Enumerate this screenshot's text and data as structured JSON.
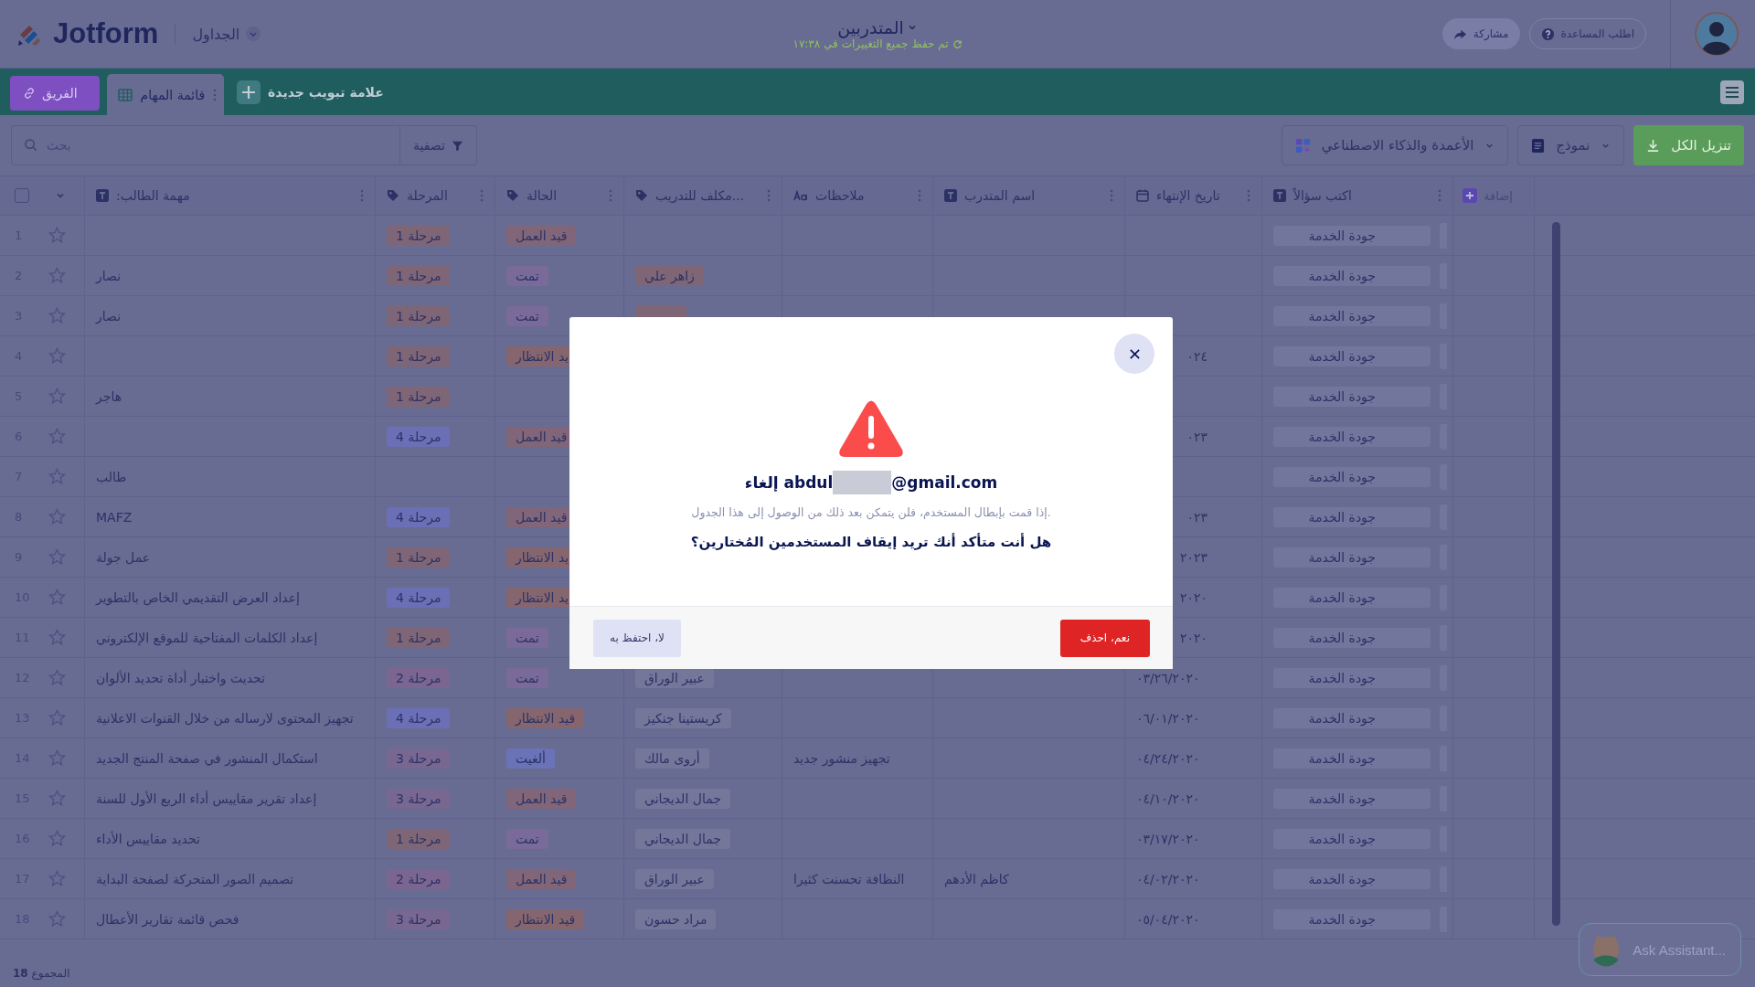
{
  "top_bar": {
    "logo": "Jotform",
    "section": "الجداول",
    "title": "المتدربين",
    "save_status": "تم حفظ جميع التغييرات في ١٧:٣٨",
    "share": "مشاركة",
    "help": "اطلب المساعدة"
  },
  "tab_bar": {
    "team_button": "الفريق",
    "tabs": [
      {
        "label": "قائمة المهام",
        "selected": true
      }
    ],
    "new_tab": "علامة تبويب جديدة"
  },
  "toolbar": {
    "search": {
      "placeholder": "بحث"
    },
    "filter": "تصفية",
    "columns_ai": "الأعمدة والذكاء الاصطناعي",
    "form": "نموذج",
    "download": "تنزيل الكل"
  },
  "table": {
    "select_all": {
      "checked": false
    },
    "columns": [
      {
        "label": "اكتب سؤالاً",
        "kind": "text"
      },
      {
        "label": "تاريخ الإنتهاء",
        "kind": "date"
      },
      {
        "label": "اسم المتدرب",
        "kind": "text"
      },
      {
        "label": "ملاحظات",
        "kind": "longtext"
      },
      {
        "label": "...مكلف للتدريب",
        "kind": "tag"
      },
      {
        "label": "الحالة",
        "kind": "tag"
      },
      {
        "label": "المرحلة",
        "kind": "tag"
      },
      {
        "label": "مهمة الطالب:",
        "kind": "text"
      }
    ],
    "add_column": "إضافة",
    "rows": [
      {
        "number": "1",
        "stage": {
          "text": "مرحلة 1",
          "color": "#7f6676"
        },
        "status": {
          "text": "قيد العمل",
          "color": "#806678"
        },
        "question": {
          "text": "جودة الخدمة",
          "color": "#72769c"
        }
      },
      {
        "number": "2",
        "task": "نصار",
        "stage": {
          "text": "مرحلة 1",
          "color": "#7f6676"
        },
        "status": {
          "text": "تمت",
          "color": "#7a6a99"
        },
        "assignee": {
          "text": "زاهر علي",
          "color": "#7f6676"
        },
        "question": {
          "text": "جودة الخدمة",
          "color": "#72769c"
        }
      },
      {
        "number": "3",
        "task": "نصار",
        "stage": {
          "text": "مرحلة 1",
          "color": "#7f6676"
        },
        "status": {
          "text": "تمت",
          "color": "#7a6a99"
        },
        "assignee": {
          "color": "#7f6676"
        },
        "question": {
          "text": "جودة الخدمة",
          "color": "#72769c"
        }
      },
      {
        "number": "4",
        "stage": {
          "text": "مرحلة 1",
          "color": "#7f6676"
        },
        "status": {
          "text": "يد الانتظار",
          "color": "#86666e",
          "partial": true
        },
        "end_date": {
          "text": "٠٢٤",
          "partial": true
        },
        "question": {
          "text": "جودة الخدمة",
          "color": "#72769c"
        }
      },
      {
        "number": "5",
        "task": "هاجر",
        "stage": {
          "text": "مرحلة 1",
          "color": "#7f6676"
        },
        "question": {
          "text": "جودة الخدمة",
          "color": "#72769c"
        }
      },
      {
        "number": "6",
        "stage": {
          "text": "مرحلة 4",
          "color": "#6b6fb5"
        },
        "status": {
          "text": "قيد العمل",
          "color": "#806678"
        },
        "end_date": {
          "text": "٠٢٣",
          "partial": true
        },
        "question": {
          "text": "جودة الخدمة",
          "color": "#72769c"
        }
      },
      {
        "number": "7",
        "task": "طالب",
        "question": {
          "text": "جودة الخدمة",
          "color": "#72769c"
        }
      },
      {
        "number": "8",
        "task": "MAFZ",
        "stage": {
          "text": "مرحلة 4",
          "color": "#6b6fb5"
        },
        "status": {
          "text": "قيد العمل",
          "color": "#806678"
        },
        "end_date": {
          "text": "٠٢٣",
          "partial": true
        },
        "question": {
          "text": "جودة الخدمة",
          "color": "#72769c"
        }
      },
      {
        "number": "9",
        "task": "عمل جولة",
        "stage": {
          "text": "مرحلة 1",
          "color": "#7f6676"
        },
        "status": {
          "text": "يد الانتظار",
          "color": "#86666e",
          "partial": true
        },
        "end_date": {
          "text": "٢٠٢٣",
          "partial": true
        },
        "question": {
          "text": "جودة الخدمة",
          "color": "#72769c"
        }
      },
      {
        "number": "10",
        "task": "إعداد العرض التقديمي الخاص بالتطوير",
        "stage": {
          "text": "مرحلة 4",
          "color": "#6b6fb5"
        },
        "status": {
          "text": "يد الانتظار",
          "color": "#86666e",
          "partial": true
        },
        "end_date": {
          "text": "٢٠٢٠",
          "partial": true
        },
        "question": {
          "text": "جودة الخدمة",
          "color": "#72769c"
        }
      },
      {
        "number": "11",
        "task": "إعداد الكلمات المفتاحية للموقع الإلكتروني",
        "stage": {
          "text": "مرحلة 1",
          "color": "#7f6676"
        },
        "status": {
          "text": "تمت",
          "color": "#7a6a99"
        },
        "end_date": {
          "text": "٢٠٢٠",
          "partial": true
        },
        "question": {
          "text": "جودة الخدمة",
          "color": "#72769c"
        }
      },
      {
        "number": "12",
        "task": "تحديث واختبار أداة تحديد الألوان",
        "stage": {
          "text": "مرحلة 2",
          "color": "#7a6690"
        },
        "status": {
          "text": "تمت",
          "color": "#7a6a99"
        },
        "assignee": {
          "text": "عبير الوراق",
          "color": "#74779a"
        },
        "end_date": {
          "text": "٠٣/٢٦/٢٠٢٠",
          "partial": false
        },
        "question": {
          "text": "جودة الخدمة",
          "color": "#72769c"
        }
      },
      {
        "number": "13",
        "task": "تجهيز المحتوى لارساله من خلال القنوات الاعلانية",
        "stage": {
          "text": "مرحلة 4",
          "color": "#6b6fb5"
        },
        "status": {
          "text": "قيد الانتظار",
          "color": "#86666e"
        },
        "assignee": {
          "text": "كريستينا جنكيز",
          "color": "#74779a"
        },
        "end_date": {
          "text": "٠٦/٠١/٢٠٢٠",
          "partial": false
        },
        "question": {
          "text": "جودة الخدمة",
          "color": "#72769c"
        }
      },
      {
        "number": "14",
        "task": "استكمال المنشور في صفحة المنتج الجديد",
        "stage": {
          "text": "مرحلة 3",
          "color": "#786790"
        },
        "status": {
          "text": "ألغيت",
          "color": "#6a72b8"
        },
        "assignee": {
          "text": "أروى مالك",
          "color": "#74779a"
        },
        "notes": "تجهيز منشور جديد",
        "end_date": {
          "text": "٠٤/٢٤/٢٠٢٠",
          "partial": false
        },
        "question": {
          "text": "جودة الخدمة",
          "color": "#72769c"
        }
      },
      {
        "number": "15",
        "task": "إعداد تقرير مقاييس أداء الربع الأول للسنة",
        "stage": {
          "text": "مرحلة 3",
          "color": "#786790"
        },
        "status": {
          "text": "قيد العمل",
          "color": "#806678"
        },
        "assignee": {
          "text": "جمال الديجاني",
          "color": "#74779a"
        },
        "end_date": {
          "text": "٠٤/١٠/٢٠٢٠",
          "partial": false
        },
        "question": {
          "text": "جودة الخدمة",
          "color": "#72769c"
        }
      },
      {
        "number": "16",
        "task": "تحديد مقاييس الأداء",
        "stage": {
          "text": "مرحلة 1",
          "color": "#7f6676"
        },
        "status": {
          "text": "تمت",
          "color": "#7a6a99"
        },
        "assignee": {
          "text": "جمال الديجاني",
          "color": "#74779a"
        },
        "end_date": {
          "text": "٠٣/١٧/٢٠٢٠",
          "partial": false
        },
        "question": {
          "text": "جودة الخدمة",
          "color": "#72769c"
        }
      },
      {
        "number": "17",
        "task": "تصميم الصور المتحركة لصفحة البداية",
        "stage": {
          "text": "مرحلة 2",
          "color": "#7a6690"
        },
        "status": {
          "text": "قيد العمل",
          "color": "#806678"
        },
        "assignee": {
          "text": "عبير الوراق",
          "color": "#74779a"
        },
        "notes": "النظافة تحسنت كثيرا",
        "trainer": "كاظم الأدهم",
        "end_date": {
          "text": "٠٤/٠٢/٢٠٢٠",
          "partial": false
        },
        "question": {
          "text": "جودة الخدمة",
          "color": "#72769c"
        }
      },
      {
        "number": "18",
        "task": "فحص قائمة تقارير الأعطال",
        "stage": {
          "text": "مرحلة 3",
          "color": "#786790"
        },
        "status": {
          "text": "قيد الانتظار",
          "color": "#86666e"
        },
        "assignee": {
          "text": "مراد حسون",
          "color": "#74779a"
        },
        "end_date": {
          "text": "٠٥/٠٤/٢٠٢٠",
          "partial": false
        },
        "question": {
          "text": "جودة الخدمة",
          "color": "#72769c"
        }
      }
    ],
    "footer": "المجموع **18**"
  },
  "assistant": "Ask Assistant...",
  "dialog": {
    "title_parts": [
      "@gmail.com",
      "إلغاء abdul"
    ],
    "message": "إذا قمت بإبطال المستخدم، فلن يتمكن بعد ذلك من الوصول إلى هذا الجدول.",
    "question": "هل أنت متأكد أنك تريد إيقاف المستخدمين المُختارين؟",
    "cancel": "لا، احتفظ به",
    "confirm": "نعم، احذف"
  }
}
